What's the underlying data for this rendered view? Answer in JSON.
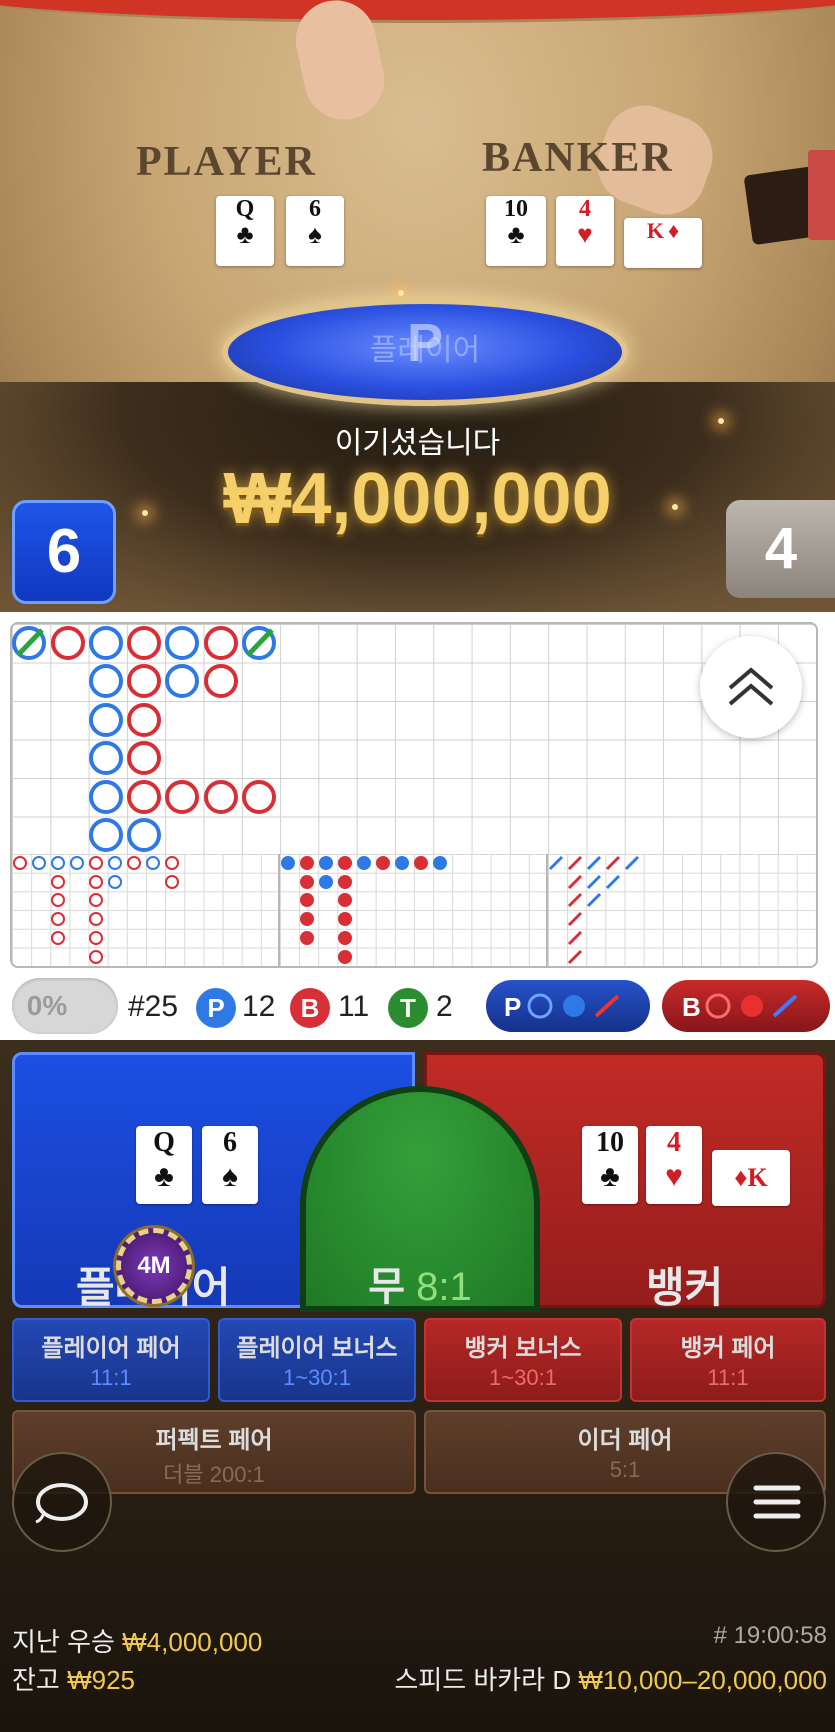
{
  "video": {
    "player_label": "PLAYER",
    "banker_label": "BANKER",
    "player_cards": [
      {
        "rank": "Q",
        "suit": "♣",
        "color": "black"
      },
      {
        "rank": "6",
        "suit": "♠",
        "color": "black"
      }
    ],
    "banker_cards": [
      {
        "rank": "10",
        "suit": "♣",
        "color": "black"
      },
      {
        "rank": "4",
        "suit": "♥",
        "color": "red"
      },
      {
        "rank": "K",
        "suit": "♦",
        "color": "red"
      }
    ],
    "winner_oval_label": "플레이어",
    "winner_oval_letter": "P",
    "win_message": "이기셨습니다",
    "win_amount": "₩4,000,000",
    "player_score": "6",
    "banker_score": "4"
  },
  "stats": {
    "percent_toggle": "0%",
    "round_number": "#25",
    "player_letter": "P",
    "player_count": "12",
    "banker_letter": "B",
    "banker_count": "11",
    "tie_letter": "T",
    "tie_count": "2",
    "predict_player_letter": "P",
    "predict_banker_letter": "B"
  },
  "bets": {
    "player": {
      "label": "플레이어",
      "cards": [
        {
          "rank": "Q",
          "suit": "♣",
          "color": "black"
        },
        {
          "rank": "6",
          "suit": "♠",
          "color": "black"
        }
      ]
    },
    "tie": {
      "label": "무",
      "odds": "8:1"
    },
    "banker": {
      "label": "뱅커",
      "cards": [
        {
          "rank": "10",
          "suit": "♣",
          "color": "black"
        },
        {
          "rank": "4",
          "suit": "♥",
          "color": "red"
        },
        {
          "rank": "K",
          "suit": "♦",
          "color": "red"
        }
      ]
    },
    "chip": "4M",
    "side_bets": [
      {
        "title": "플레이어 페어",
        "odds": "11:1"
      },
      {
        "title": "플레이어 보너스",
        "odds": "1~30:1"
      },
      {
        "title": "뱅커 보너스",
        "odds": "1~30:1"
      },
      {
        "title": "뱅커 페어",
        "odds": "11:1"
      },
      {
        "title": "퍼펙트 페어",
        "odds": "더블 200:1"
      },
      {
        "title": "이더 페어",
        "odds": "5:1"
      }
    ]
  },
  "footer": {
    "last_win_label": "지난 우승",
    "last_win_amount": "₩4,000,000",
    "balance_label": "잔고",
    "balance_amount": "₩925",
    "game_id": "# 19:00:58",
    "table_name": "스피드 바카라 D",
    "table_limits": "₩10,000–20,000,000"
  },
  "icons": {
    "collapse": "double-chevron-up-icon",
    "chat": "chat-bubble-icon",
    "menu": "hamburger-menu-icon"
  },
  "colors": {
    "player_blue": "#1c4fe3",
    "banker_red": "#c12b26",
    "tie_green": "#2a8d30",
    "gold": "#f1c94f"
  }
}
